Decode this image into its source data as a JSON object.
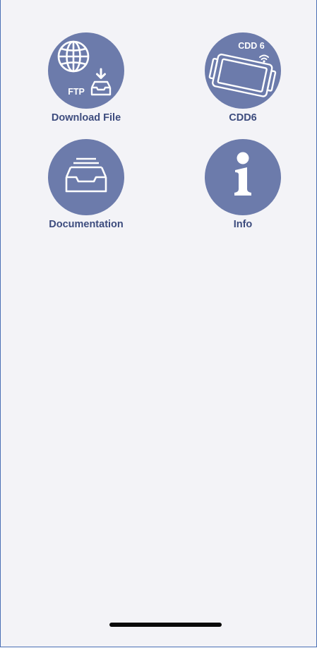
{
  "tiles": {
    "download": {
      "label": "Download File",
      "icon_text": "FTP",
      "icon": "globe-download-icon"
    },
    "cdd6": {
      "label": "CDD6",
      "icon_text": "CDD 6",
      "icon": "cdd6-device-icon"
    },
    "documentation": {
      "label": "Documentation",
      "icon": "document-tray-icon"
    },
    "info": {
      "label": "Info",
      "icon": "info-icon"
    }
  },
  "colors": {
    "background": "#f3f3f7",
    "tile_circle": "#6c7bab",
    "label": "#3d4c7e",
    "icon": "#ffffff"
  }
}
